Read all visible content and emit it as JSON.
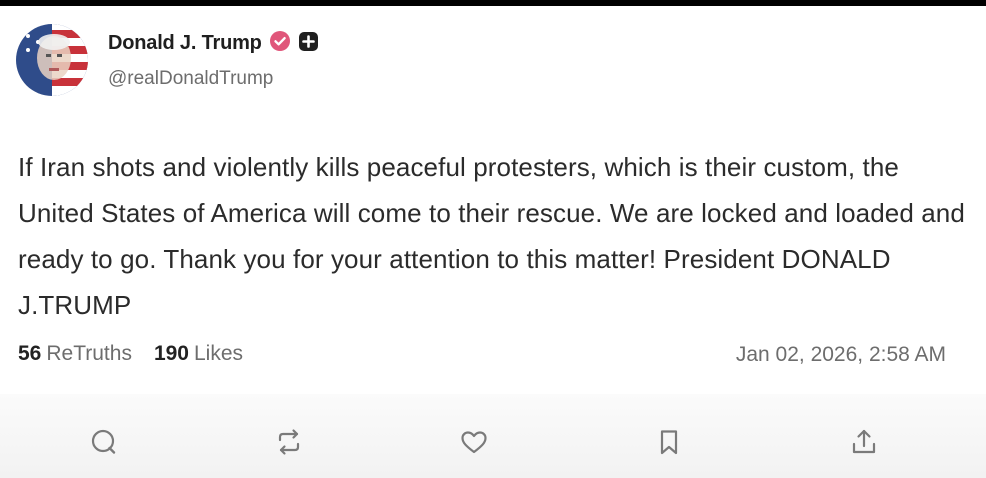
{
  "author": {
    "display_name": "Donald J. Trump",
    "handle": "@realDonaldTrump",
    "avatar": "avatar-flag-portrait",
    "verified_icon": "verified-badge-icon",
    "extra_badge_icon": "plus-badge-icon"
  },
  "post": {
    "text": "If Iran shots and violently kills peaceful protesters, which is their custom, the United States of America will come to their rescue. We are locked and loaded and ready to go. Thank you for your attention to this matter! President DONALD J.TRUMP"
  },
  "stats": {
    "retruths_count": "56",
    "retruths_label": "ReTruths",
    "likes_count": "190",
    "likes_label": "Likes"
  },
  "timestamp": "Jan 02, 2026, 2:58 AM",
  "actions": [
    {
      "icon": "reply-icon"
    },
    {
      "icon": "retruth-icon"
    },
    {
      "icon": "like-icon"
    },
    {
      "icon": "bookmark-icon"
    },
    {
      "icon": "share-icon"
    }
  ],
  "colors": {
    "verified_badge": "#e0567a",
    "icon_gray": "#7a7a7a",
    "text_dark": "#222222",
    "text_muted": "#6d6d6d"
  }
}
